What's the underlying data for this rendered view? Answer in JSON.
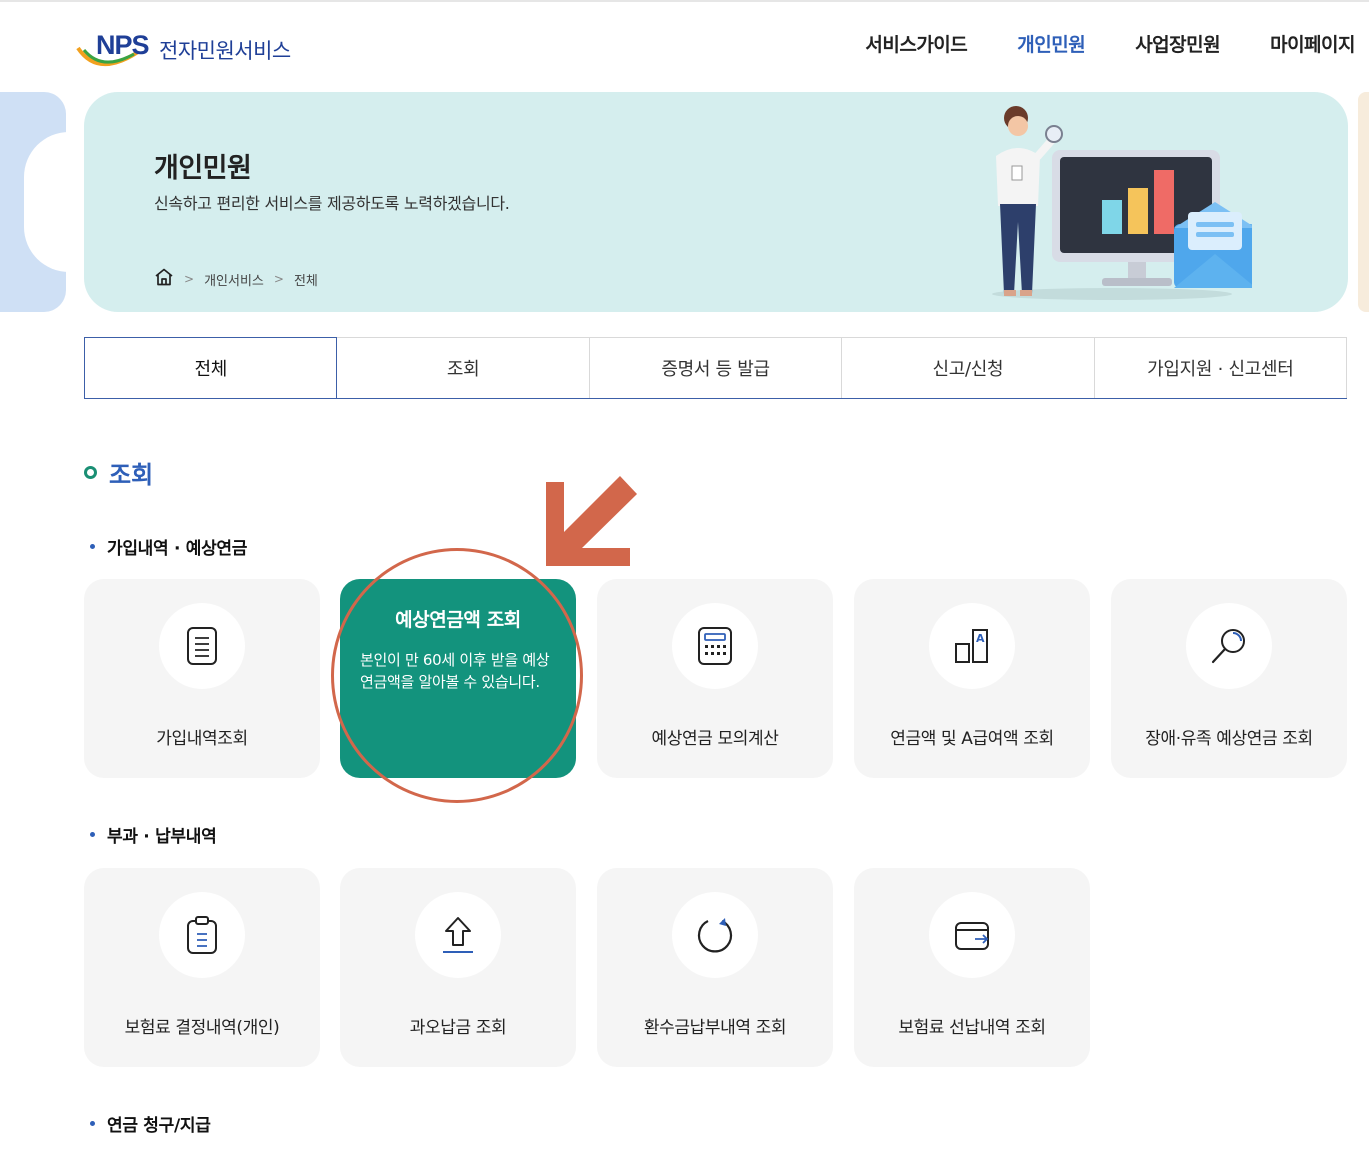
{
  "header": {
    "logo_mark": "NPS",
    "logo_text": "전자민원서비스",
    "nav": [
      {
        "label": "서비스가이드",
        "active": false
      },
      {
        "label": "개인민원",
        "active": true
      },
      {
        "label": "사업장민원",
        "active": false
      },
      {
        "label": "마이페이지",
        "active": false
      }
    ]
  },
  "banner": {
    "title": "개인민원",
    "description": "신속하고 편리한 서비스를 제공하도록 노력하겠습니다.",
    "breadcrumb": [
      "개인서비스",
      "전체"
    ]
  },
  "tabs": [
    {
      "label": "전체",
      "selected": true
    },
    {
      "label": "조회",
      "selected": false
    },
    {
      "label": "증명서 등 발급",
      "selected": false
    },
    {
      "label": "신고/신청",
      "selected": false
    },
    {
      "label": "가입지원 · 신고센터",
      "selected": false
    }
  ],
  "section": {
    "title": "조회",
    "groups": [
      {
        "title": "가입내역 · 예상연금",
        "cards": [
          {
            "label": "가입내역조회",
            "icon": "document-list-icon"
          },
          {
            "label": "예상연금액 조회",
            "icon": "pension-icon",
            "hover_desc": "본인이 만 60세 이후 받을 예상연금액을 알아볼 수 있습니다."
          },
          {
            "label": "예상연금 모의계산",
            "icon": "calculator-icon"
          },
          {
            "label": "연금액 및 A급여액 조회",
            "icon": "bar-a-icon"
          },
          {
            "label": "장애·유족 예상연금 조회",
            "icon": "magnifier-icon"
          }
        ]
      },
      {
        "title": "부과 · 납부내역",
        "cards": [
          {
            "label": "보험료 결정내역(개인)",
            "icon": "clipboard-icon"
          },
          {
            "label": "과오납금 조회",
            "icon": "upload-icon"
          },
          {
            "label": "환수금납부내역 조회",
            "icon": "refresh-icon"
          },
          {
            "label": "보험료 선납내역 조회",
            "icon": "wallet-icon"
          }
        ]
      },
      {
        "title": "연금 청구/지급",
        "cards": []
      }
    ]
  },
  "colors": {
    "brand_blue": "#1f3f97",
    "active_nav": "#2e5fb8",
    "banner_bg": "#d5eeee",
    "card_hover": "#13937d",
    "annotation": "#d2674b"
  }
}
